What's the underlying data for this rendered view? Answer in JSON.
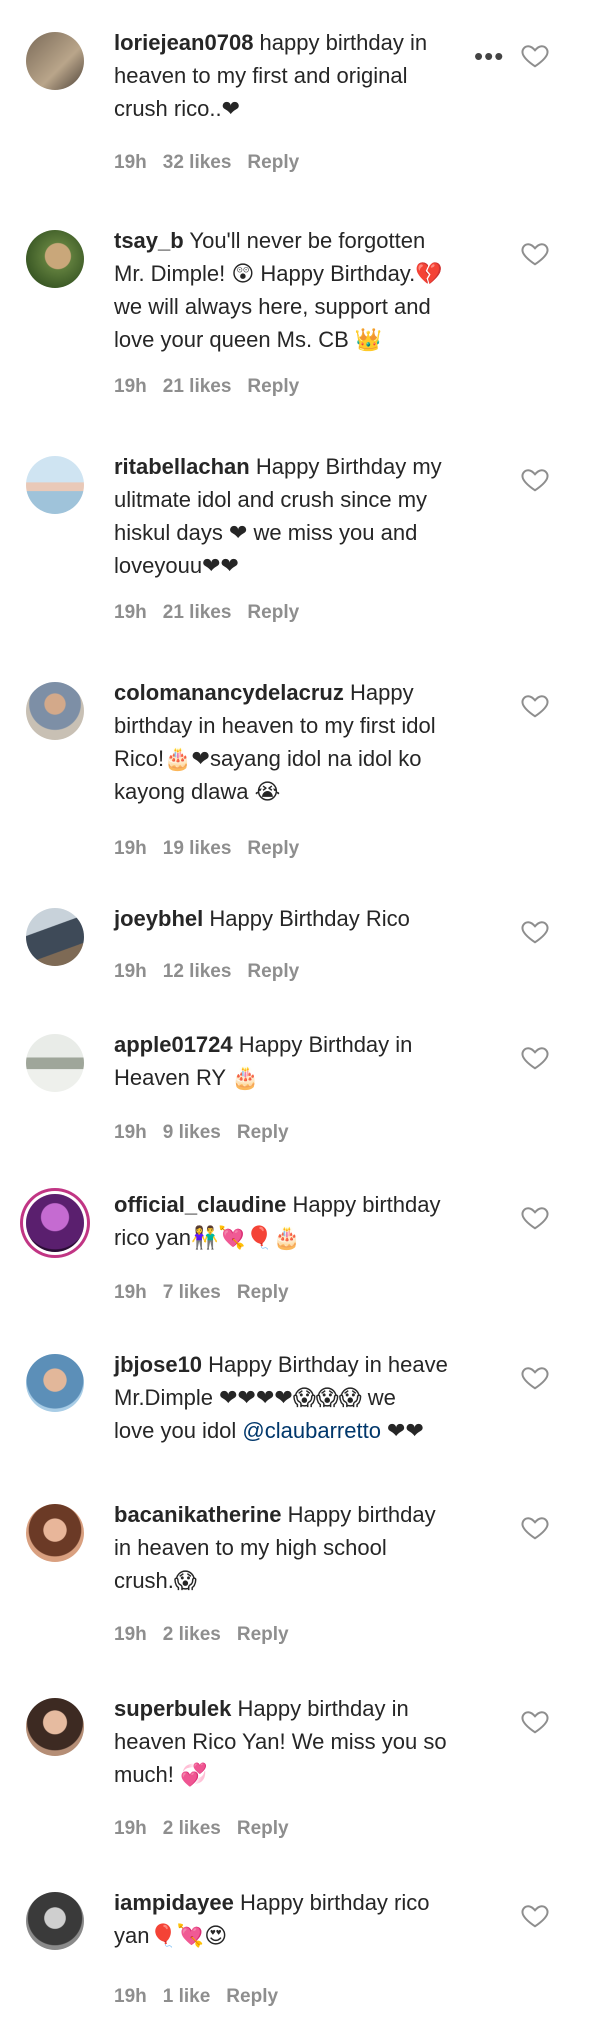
{
  "colors": {
    "text": "#262626",
    "meta": "#8e8e8e",
    "mention": "#00376b",
    "story_ring": "#c13584"
  },
  "icons": {
    "like": "heart-outline-icon",
    "more": "ellipsis-icon"
  },
  "comments": [
    {
      "username": "loriejean0708",
      "text": " happy birthday in\nheaven to my first and original\ncrush rico..❤",
      "time": "19h",
      "likes": "32 likes",
      "reply": "Reply",
      "more": "•••"
    },
    {
      "username": "tsay_b",
      "text": " You'll never be forgotten\nMr. Dimple! 😲 Happy Birthday.💔\nwe will always here, support and\nlove your queen Ms. CB 👑",
      "time": "19h",
      "likes": "21 likes",
      "reply": "Reply"
    },
    {
      "username": "ritabellachan",
      "text": " Happy Birthday my\nulitmate idol and crush since my\nhiskul days ❤ we miss you and\nloveyouu❤❤",
      "time": "19h",
      "likes": "21 likes",
      "reply": "Reply"
    },
    {
      "username": "colomanancydelacruz",
      "text": " Happy\nbirthday in heaven to my first idol\nRico!🎂❤sayang idol na idol ko\nkayong dlawa 😭",
      "time": "19h",
      "likes": "19 likes",
      "reply": "Reply"
    },
    {
      "username": "joeybhel",
      "text": " Happy Birthday Rico",
      "time": "19h",
      "likes": "12 likes",
      "reply": "Reply"
    },
    {
      "username": "apple01724",
      "text": " Happy Birthday in\nHeaven RY 🎂",
      "time": "19h",
      "likes": "9 likes",
      "reply": "Reply"
    },
    {
      "username": "official_claudine",
      "text": " Happy birthday\nrico yan👫💘🎈🎂",
      "time": "19h",
      "likes": "7 likes",
      "reply": "Reply"
    },
    {
      "username": "jbjose10",
      "text_a": " Happy Birthday in heave\nMr.Dimple ❤❤❤❤😱😱😱 we\nlove you idol ",
      "mention": "@claubarretto",
      "text_b": " ❤❤",
      "time": "",
      "likes": "",
      "reply": ""
    },
    {
      "username": "bacanikatherine",
      "text": " Happy birthday\nin heaven to my high school\ncrush.😱",
      "time": "19h",
      "likes": "2 likes",
      "reply": "Reply"
    },
    {
      "username": "superbulek",
      "text": " Happy birthday in\nheaven Rico Yan! We miss you so\nmuch! 💞",
      "time": "19h",
      "likes": "2 likes",
      "reply": "Reply"
    },
    {
      "username": "iampidayee",
      "text": " Happy birthday rico\nyan🎈💘😍",
      "time": "19h",
      "likes": "1 like",
      "reply": "Reply"
    }
  ]
}
